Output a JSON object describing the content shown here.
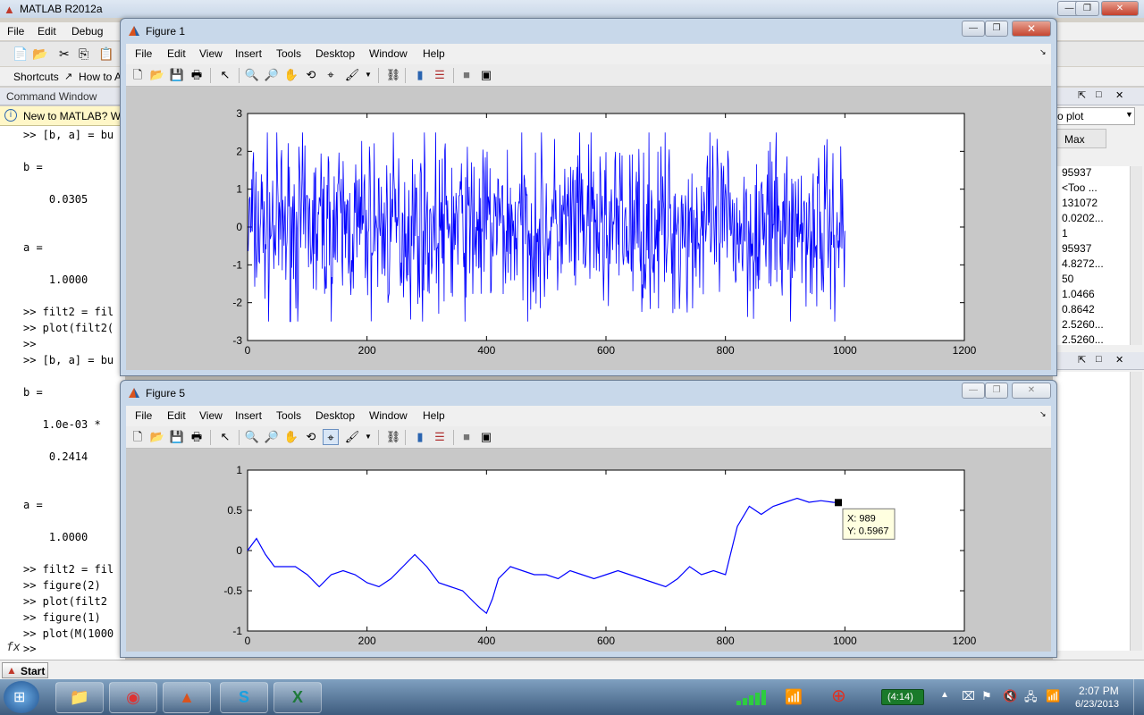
{
  "main_window": {
    "title": "MATLAB  R2012a",
    "menu": [
      "File",
      "Edit",
      "Debug"
    ],
    "shortcuts_label": "Shortcuts",
    "howto_label": "How to A",
    "cmd_header": "Command Window",
    "info_text": "New to MATLAB? W",
    "prompt_symbol": ">>",
    "fx_label": "fx",
    "command_lines": [
      ">> [b, a] = bu",
      "",
      "b =",
      "",
      "    0.0305",
      "",
      "",
      "a =",
      "",
      "    1.0000",
      "",
      ">> filt2 = fil",
      ">> plot(filt2(",
      ">>",
      ">> [b, a] = bu",
      "",
      "b =",
      "",
      "   1.0e-03 *",
      "",
      "    0.2414",
      "",
      "",
      "a =",
      "",
      "    1.0000",
      "",
      ">> filt2 = fil",
      ">> figure(2)",
      ">> plot(filt2",
      ">> figure(1)",
      ">> plot(M(1000"
    ]
  },
  "workspace_panel": {
    "dropdown_value": "o plot",
    "column_header": "Max",
    "values": [
      "95937",
      "<Too ...",
      "131072",
      "0.0202...",
      "1",
      "95937",
      "4.8272...",
      "50",
      "1.0466",
      "0.8642",
      "2.5260...",
      "2.5260..."
    ]
  },
  "figure_menu": [
    "File",
    "Edit",
    "View",
    "Insert",
    "Tools",
    "Desktop",
    "Window",
    "Help"
  ],
  "figure1": {
    "title": "Figure 1",
    "chart_data": {
      "type": "line",
      "color": "#0000ff",
      "x_range": [
        0,
        1000
      ],
      "xlim": [
        0,
        1200
      ],
      "ylim": [
        -3,
        3
      ],
      "xticks": [
        0,
        200,
        400,
        600,
        800,
        1000,
        1200
      ],
      "yticks": [
        -3,
        -2,
        -1,
        0,
        1,
        2,
        3
      ],
      "series_description_values": {
        "n_points": 1000,
        "min": -2.5,
        "max": 2.5
      }
    }
  },
  "figure5": {
    "title": "Figure 5",
    "chart_data": {
      "type": "line",
      "color": "#0000ff",
      "xlim": [
        0,
        1200
      ],
      "ylim": [
        -1,
        1
      ],
      "xticks": [
        0,
        200,
        400,
        600,
        800,
        1000,
        1200
      ],
      "yticks": [
        -1,
        -0.5,
        0,
        0.5,
        1
      ],
      "x": [
        0,
        15,
        30,
        45,
        60,
        80,
        100,
        120,
        140,
        160,
        180,
        200,
        220,
        240,
        260,
        280,
        300,
        320,
        340,
        360,
        380,
        390,
        400,
        410,
        420,
        440,
        460,
        480,
        500,
        520,
        540,
        560,
        580,
        600,
        620,
        640,
        660,
        680,
        700,
        720,
        740,
        760,
        780,
        800,
        820,
        840,
        860,
        880,
        900,
        920,
        940,
        960,
        980,
        989
      ],
      "y": [
        0.0,
        0.15,
        -0.05,
        -0.2,
        -0.2,
        -0.2,
        -0.3,
        -0.45,
        -0.3,
        -0.25,
        -0.3,
        -0.4,
        -0.45,
        -0.35,
        -0.2,
        -0.05,
        -0.2,
        -0.4,
        -0.45,
        -0.5,
        -0.65,
        -0.72,
        -0.78,
        -0.6,
        -0.35,
        -0.2,
        -0.25,
        -0.3,
        -0.3,
        -0.35,
        -0.25,
        -0.3,
        -0.35,
        -0.3,
        -0.25,
        -0.3,
        -0.35,
        -0.4,
        -0.45,
        -0.35,
        -0.2,
        -0.3,
        -0.25,
        -0.3,
        0.3,
        0.55,
        0.45,
        0.55,
        0.6,
        0.65,
        0.6,
        0.62,
        0.6,
        0.5967
      ],
      "datatip": {
        "label_x": "X: 989",
        "label_y": "Y: 0.5967",
        "x": 989,
        "y": 0.5967
      }
    }
  },
  "taskbar": {
    "start_label": "Start",
    "battery_label": "(4:14)",
    "clock_time": "2:07 PM",
    "clock_date": "6/23/2013"
  }
}
